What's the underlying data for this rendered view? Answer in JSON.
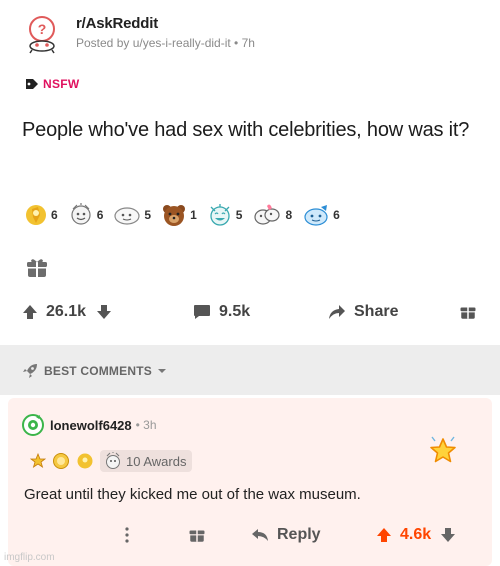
{
  "post": {
    "subreddit": "r/AskReddit",
    "posted_by": "Posted by u/yes-i-really-did-it • 7h",
    "flair": "NSFW",
    "title": "People who've had sex with celebrities, how was it?",
    "awards": [
      {
        "icon": "helpful-award-icon",
        "count": "6"
      },
      {
        "icon": "wholesome-award-icon",
        "count": "6"
      },
      {
        "icon": "silver-award-icon",
        "count": "5"
      },
      {
        "icon": "bear-award-icon",
        "count": "1"
      },
      {
        "icon": "laughing-award-icon",
        "count": "5"
      },
      {
        "icon": "hugz-award-icon",
        "count": "8"
      },
      {
        "icon": "blue-snoo-award-icon",
        "count": "6"
      }
    ],
    "upvotes": "26.1k",
    "comments": "9.5k",
    "share": "Share"
  },
  "sort": {
    "label": "BEST COMMENTS"
  },
  "comment": {
    "username": "lonewolf6428",
    "time": "• 3h",
    "awards_label": "10 Awards",
    "body": "Great until they kicked me out of the wax museum.",
    "reply": "Reply",
    "score": "4.6k"
  },
  "watermark": "imgflip.com",
  "colors": {
    "nsfw": "#e0115f",
    "upvote_active": "#ff4500",
    "sort_bar": "#ededed",
    "highlight": "#fff1ee"
  }
}
